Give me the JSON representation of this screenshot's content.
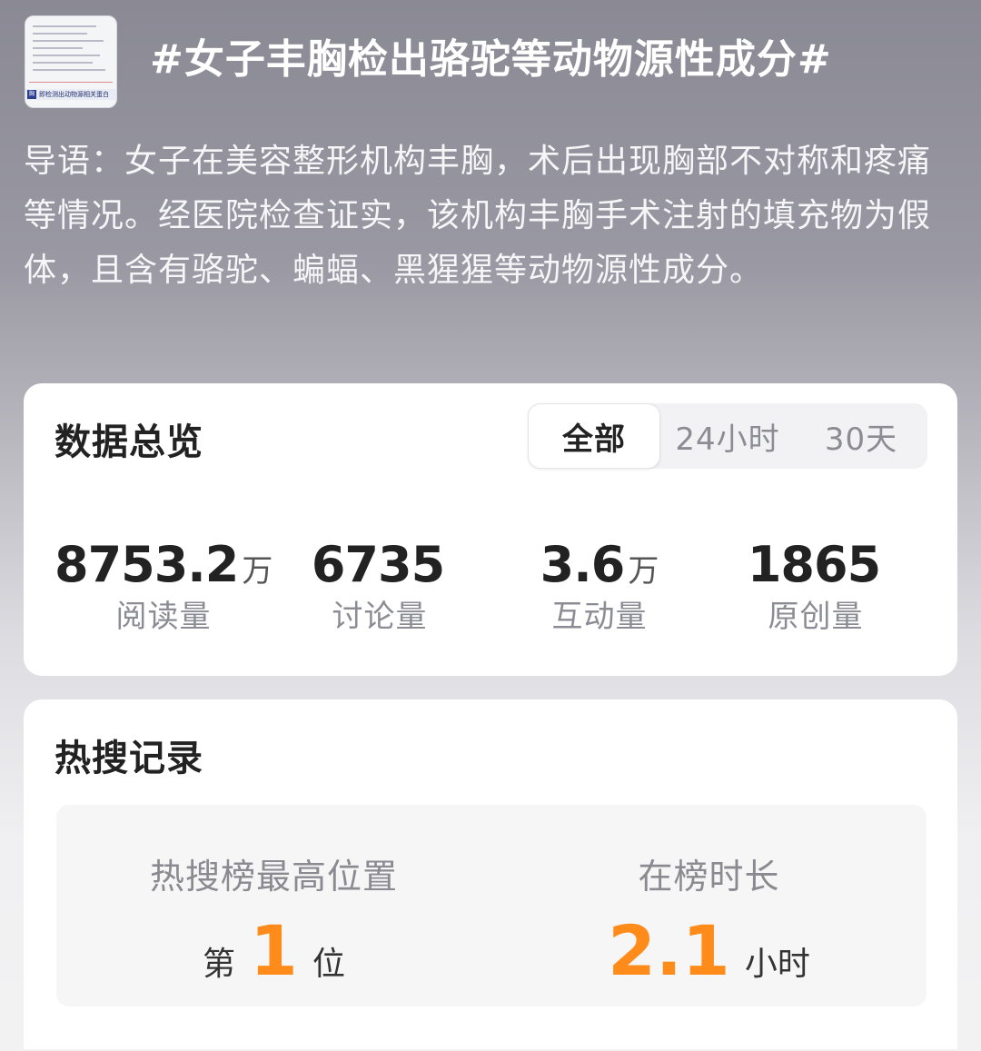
{
  "topic": {
    "title": "#女子丰胸检出骆驼等动物源性成分#",
    "intro": "导语：女子在美容整形机构丰胸，术后出现胸部不对称和疼痛等情况。经医院检查证实，该机构丰胸手术注射的填充物为假体，且含有骆驼、蝙蝠、黑猩猩等动物源性成分。",
    "thumbnail_caption": "即检测出动物源相关蛋白"
  },
  "overview": {
    "title": "数据总览",
    "tabs": [
      {
        "label": "全部",
        "active": true
      },
      {
        "label": "24小时",
        "active": false
      },
      {
        "label": "30天",
        "active": false
      }
    ],
    "stats": [
      {
        "value": "8753.2",
        "unit": "万",
        "label": "阅读量"
      },
      {
        "value": "6735",
        "unit": "",
        "label": "讨论量"
      },
      {
        "value": "3.6",
        "unit": "万",
        "label": "互动量"
      },
      {
        "value": "1865",
        "unit": "",
        "label": "原创量"
      }
    ]
  },
  "hot_search": {
    "title": "热搜记录",
    "highest": {
      "label": "热搜榜最高位置",
      "prefix": "第",
      "value": "1",
      "suffix": "位"
    },
    "duration": {
      "label": "在榜时长",
      "value": "2.1",
      "suffix": "小时"
    }
  },
  "colors": {
    "accent": "#ff8c1a"
  }
}
